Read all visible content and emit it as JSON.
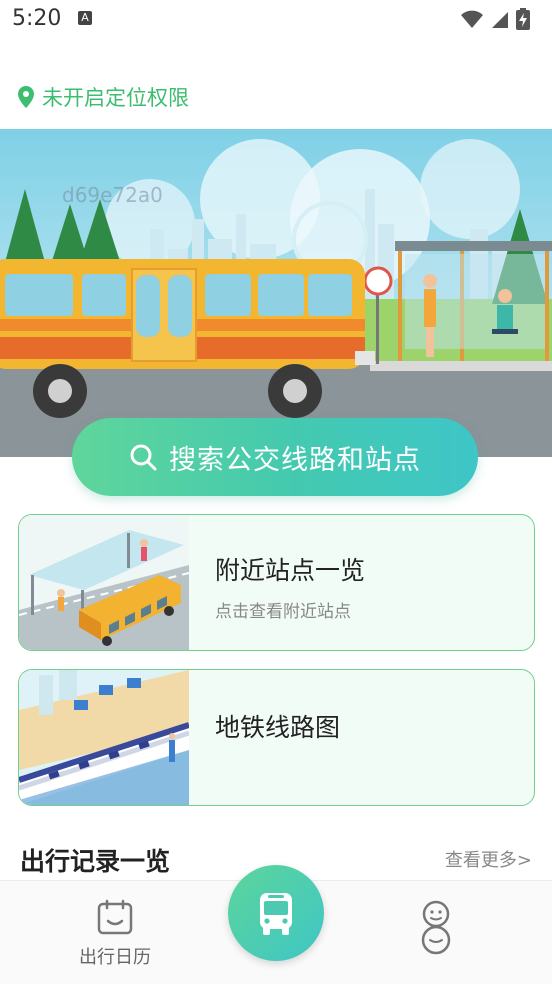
{
  "status_bar": {
    "time": "5:20",
    "icons": [
      "a-badge-icon",
      "wifi-icon",
      "signal-icon",
      "battery-charging-icon"
    ]
  },
  "location": {
    "text": "未开启定位权限",
    "icon": "location-pin-icon",
    "color": "#3dbd6f"
  },
  "hero": {
    "watermark_id": "d69e72a0"
  },
  "search": {
    "label": "搜索公交线路和站点",
    "icon": "search-icon"
  },
  "cards": [
    {
      "title": "附近站点一览",
      "subtitle": "点击查看附近站点"
    },
    {
      "title": "地铁线路图",
      "subtitle": ""
    }
  ],
  "records": {
    "title": "出行记录一览",
    "more": "查看更多>"
  },
  "bottom_nav": {
    "left_label": "出行日历",
    "left_icon": "calendar-icon",
    "center_icon": "bus-icon",
    "right_icon": "snowman-icon"
  },
  "colors": {
    "accent_green": "#3dbd6f",
    "card_border": "#72cf8c",
    "gradient_start": "#5fd69a",
    "gradient_end": "#3ec6c8"
  }
}
